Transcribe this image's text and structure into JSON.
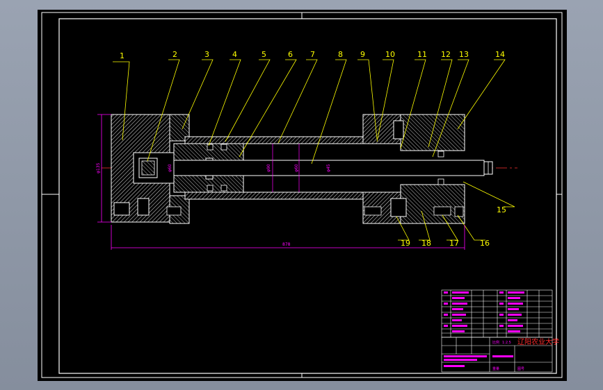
{
  "drawing": {
    "part_labels": [
      "1",
      "2",
      "3",
      "4",
      "5",
      "6",
      "7",
      "8",
      "9",
      "10",
      "11",
      "12",
      "13",
      "14",
      "15",
      "16",
      "17",
      "18",
      "19"
    ],
    "dimensions": {
      "overall_length": "878",
      "flange_diameter": "φ135",
      "diameter_a": "φ60",
      "diameter_b": "φ90",
      "diameter_c": "φ60",
      "rod_diameter": "φ45"
    },
    "title_block": {
      "school": "辽阳农业大学",
      "scale_label": "比例",
      "scale_value": "1:2.5",
      "weight_label": "重量",
      "sheet_label": "图号"
    }
  },
  "colors": {
    "frame": "#ffffff",
    "outline": "#ffffff",
    "section_hatch": "#c0c0c0",
    "centerline": "#ff3030",
    "leaders": "#ffff00",
    "dimension": "#ff00ff",
    "title_block_text": "#ff00ff",
    "school_name": "#ff2a2a"
  }
}
